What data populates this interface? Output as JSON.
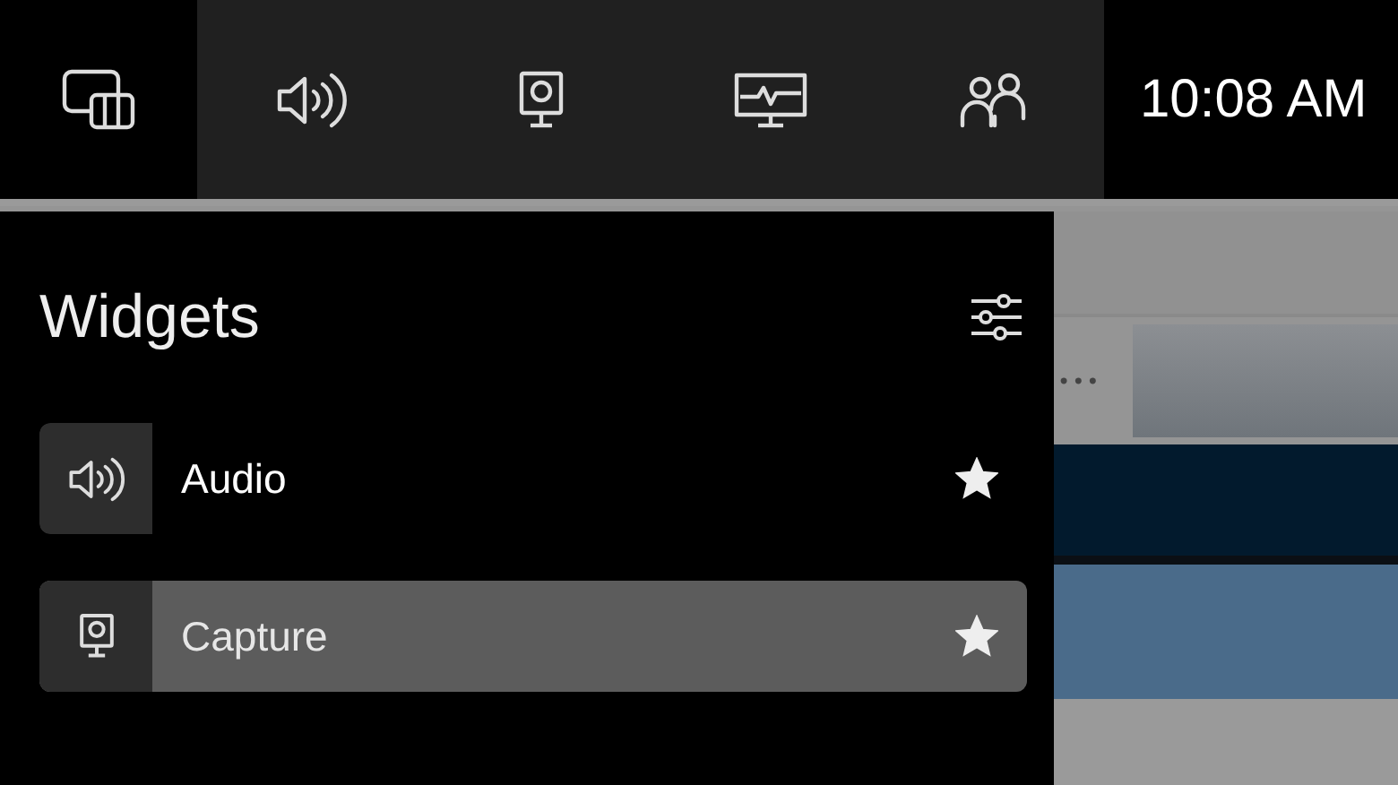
{
  "top_bar": {
    "buttons": [
      {
        "kind": "widgets",
        "selected": true
      },
      {
        "kind": "audio",
        "selected": false
      },
      {
        "kind": "capture",
        "selected": false
      },
      {
        "kind": "performance",
        "selected": false
      },
      {
        "kind": "social",
        "selected": false
      }
    ],
    "time": "10:08 AM"
  },
  "widgets_panel": {
    "title": "Widgets",
    "items": [
      {
        "kind": "audio",
        "label": "Audio",
        "favorite": true,
        "selected": false
      },
      {
        "kind": "capture",
        "label": "Capture",
        "favorite": true,
        "selected": true
      }
    ]
  },
  "background_page": {
    "more": "•••"
  }
}
